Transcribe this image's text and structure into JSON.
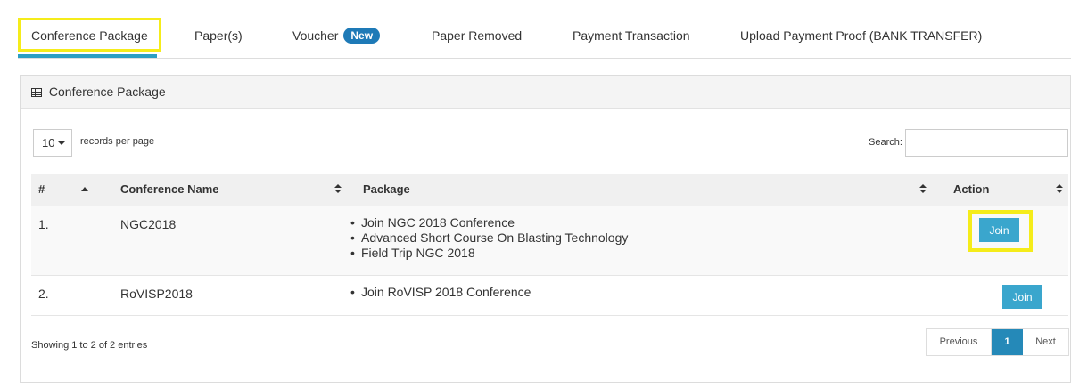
{
  "tabs": [
    {
      "label": "Conference Package",
      "active": true
    },
    {
      "label": "Paper(s)"
    },
    {
      "label": "Voucher",
      "badge": "New"
    },
    {
      "label": "Paper Removed"
    },
    {
      "label": "Payment Transaction"
    },
    {
      "label": "Upload Payment Proof (BANK TRANSFER)"
    }
  ],
  "panel": {
    "title": "Conference Package",
    "length": {
      "value": "10",
      "label": "records per page"
    },
    "search": {
      "label": "Search:",
      "value": "",
      "placeholder": ""
    }
  },
  "table": {
    "headers": {
      "num": "#",
      "name": "Conference Name",
      "package": "Package",
      "action": "Action"
    },
    "rows": [
      {
        "num": "1.",
        "name": "NGC2018",
        "packages": [
          "Join NGC 2018 Conference",
          "Advanced Short Course On Blasting Technology",
          "Field Trip NGC 2018"
        ],
        "action": "Join"
      },
      {
        "num": "2.",
        "name": "RoVISP2018",
        "packages": [
          "Join RoVISP 2018 Conference"
        ],
        "action": "Join"
      }
    ]
  },
  "footer": {
    "info": "Showing 1 to 2 of 2 entries",
    "pagination": {
      "previous": "Previous",
      "current": "1",
      "next": "Next"
    }
  },
  "colors": {
    "accent": "#3aa6cd",
    "highlight": "#f5ec1a",
    "badge": "#1e7ab7",
    "tab_underline": "#2b9fc2"
  },
  "icons": {
    "panel_title": "table-grid-icon",
    "length_caret": "caret-down-icon",
    "sort_asc": "sort-asc-icon",
    "sort_both": "sort-both-icon"
  }
}
